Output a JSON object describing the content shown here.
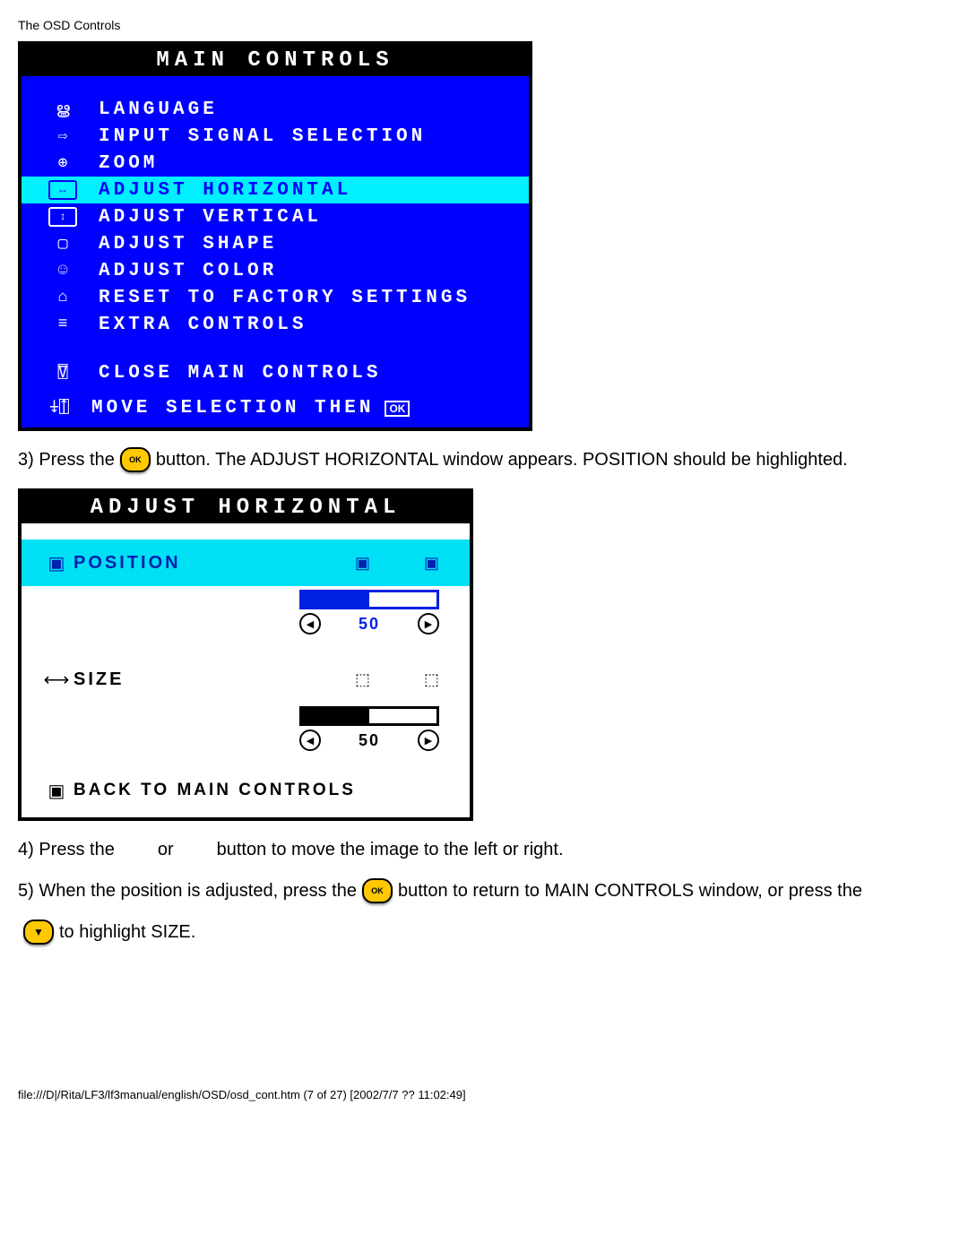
{
  "header": "The OSD Controls",
  "main_osd": {
    "title": "MAIN CONTROLS",
    "items": [
      {
        "icon_name": "globe-icon",
        "glyph": "ൠ",
        "label": "LANGUAGE"
      },
      {
        "icon_name": "input-icon",
        "glyph": "⇨",
        "label": "INPUT SIGNAL SELECTION"
      },
      {
        "icon_name": "zoom-icon",
        "glyph": "⊕",
        "label": "ZOOM"
      },
      {
        "icon_name": "horizontal-icon",
        "glyph": "↔",
        "label": "ADJUST HORIZONTAL",
        "selected": true
      },
      {
        "icon_name": "vertical-icon",
        "glyph": "↕",
        "label": "ADJUST VERTICAL"
      },
      {
        "icon_name": "shape-icon",
        "glyph": "▢",
        "label": "ADJUST SHAPE"
      },
      {
        "icon_name": "color-icon",
        "glyph": "☺",
        "label": "ADJUST COLOR"
      },
      {
        "icon_name": "reset-icon",
        "glyph": "⌂",
        "label": "RESET TO FACTORY SETTINGS"
      },
      {
        "icon_name": "extra-icon",
        "glyph": "≡",
        "label": "EXTRA CONTROLS"
      }
    ],
    "close": {
      "icon_name": "close-icon",
      "glyph": "⍔",
      "label": "CLOSE MAIN CONTROLS"
    },
    "footer": {
      "icon_name": "nav-icon",
      "glyph": "⍖⍐",
      "label": "MOVE SELECTION THEN",
      "suffix": "OK"
    }
  },
  "step3": {
    "pre": "3) Press the ",
    "post": " button. The ADJUST HORIZONTAL window appears. POSITION should be highlighted."
  },
  "adjust_osd": {
    "title": "ADJUST HORIZONTAL",
    "rows": [
      {
        "label": "POSITION",
        "value": 50,
        "selected": true
      },
      {
        "label": "SIZE",
        "value": 50,
        "selected": false
      }
    ],
    "back": "BACK TO MAIN CONTROLS"
  },
  "step4": {
    "a": "4) Press the ",
    "b": " or ",
    "c": " button to move the image to the left or right."
  },
  "step5": {
    "a": "5) When the position is adjusted, press the ",
    "b": " button to return to MAIN CONTROLS window, or press the ",
    "c": "to highlight SIZE."
  },
  "footer": "file:///D|/Rita/LF3/lf3manual/english/OSD/osd_cont.htm (7 of 27) [2002/7/7 ?? 11:02:49]",
  "chart_data": {
    "type": "bar",
    "title": "ADJUST HORIZONTAL sliders",
    "categories": [
      "POSITION",
      "SIZE"
    ],
    "values": [
      50,
      50
    ],
    "ylim": [
      0,
      100
    ],
    "xlabel": "",
    "ylabel": ""
  }
}
